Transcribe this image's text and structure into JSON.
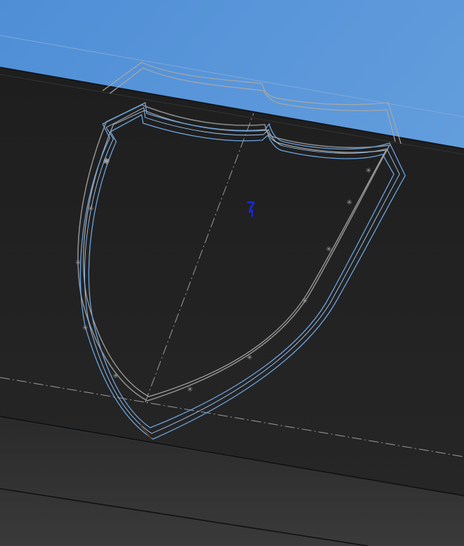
{
  "viewport": {
    "background_sky": "#5d97d6",
    "face_top_color": "#1f1f1f",
    "face_bottom_color": "#2f2f2f",
    "sketch_color": "#8c8c8c",
    "selection_color": "#6aa3e0",
    "annotation_color": "#1a2bd8"
  },
  "annotation": {
    "label": "7"
  }
}
